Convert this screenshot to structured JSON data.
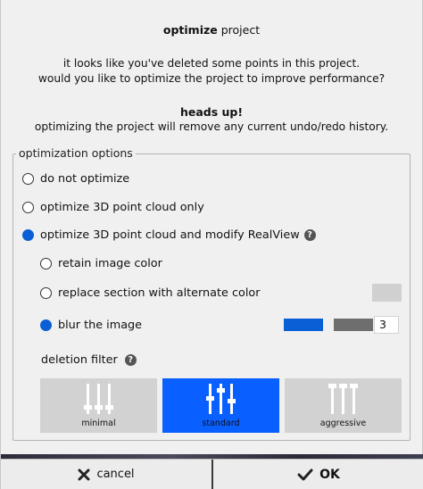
{
  "dialog": {
    "title_bold": "optimize",
    "title_rest": " project",
    "message_line1": "it looks like you've deleted some points in this project.",
    "message_line2": "would you like to optimize the project to improve performance?",
    "warning_heading": "heads up!",
    "warning_body": "optimizing the project will remove any current undo/redo history."
  },
  "options": {
    "legend": "optimization options",
    "do_not_optimize": "do not optimize",
    "cloud_only": "optimize 3D point cloud only",
    "cloud_and_realview": "optimize 3D point cloud and modify RealView",
    "retain_color": "retain image color",
    "replace_color": "replace section with alternate color",
    "blur_image": "blur the image",
    "blur_value": "3",
    "blur_fraction": 0.34,
    "alternate_color": "#d0d0d0",
    "selected_main": "cloud_and_realview",
    "selected_sub": "blur_image"
  },
  "deletion_filter": {
    "label": "deletion filter",
    "buttons": [
      {
        "label": "minimal",
        "selected": false
      },
      {
        "label": "standard",
        "selected": true
      },
      {
        "label": "aggressive",
        "selected": false
      }
    ]
  },
  "footer": {
    "cancel_label": "cancel",
    "ok_label": "OK"
  },
  "colors": {
    "accent": "#0a5fff",
    "radio_selected": "#0a5fd6"
  },
  "icons": {
    "help": "?"
  }
}
